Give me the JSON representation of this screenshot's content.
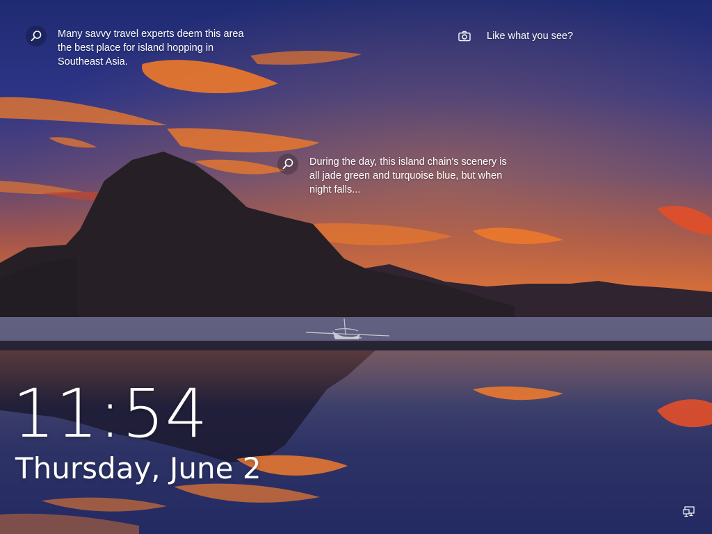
{
  "lockscreen": {
    "time": "11:54",
    "date": "Thursday, June 2"
  },
  "spotlight": {
    "hotspots": [
      {
        "icon": "search-icon",
        "text": "Many savvy travel experts deem this area the best place for island hopping in Southeast Asia."
      },
      {
        "icon": "search-icon",
        "text": "During the day, this island chain's scenery is all jade green and turquoise blue, but when night falls..."
      }
    ],
    "feedback": {
      "icon": "camera-icon",
      "label": "Like what you see?"
    }
  },
  "status": {
    "network_icon": "network-icon"
  },
  "colors": {
    "sky_top": "#1f2a6e",
    "sky_mid": "#3b3f8a",
    "horizon_glow": "#e8722a",
    "cloud_orange": "#f0792a",
    "mountain": "#2a2228",
    "water": "#3b3a5c",
    "text": "#ffffff"
  }
}
